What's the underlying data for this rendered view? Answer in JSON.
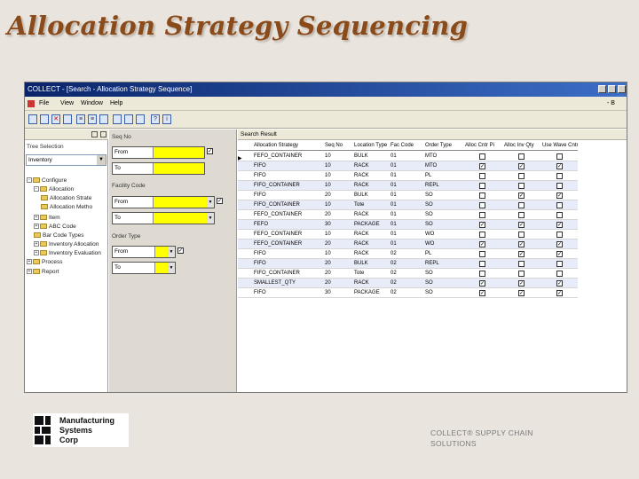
{
  "slide": {
    "title": "Allocation Strategy Sequencing",
    "footer_line1": "COLLECT® SUPPLY CHAIN",
    "footer_line2": "SOLUTIONS"
  },
  "logo": {
    "line1": "Manufacturing",
    "line2": "Systems",
    "line3": "Corp"
  },
  "window": {
    "title": "COLLECT - [Search - Allocation Strategy Sequence]",
    "menus": [
      "File",
      "View",
      "Window",
      "Help"
    ],
    "menu_right": "- B"
  },
  "left_panel": {
    "label": "Tree Selection",
    "combo_value": "Inventory",
    "tree": [
      {
        "label": "Configure",
        "level": 0,
        "expander": "-"
      },
      {
        "label": "Allocation",
        "level": 1,
        "expander": "-"
      },
      {
        "label": "Allocation Strate",
        "level": 2,
        "expander": ""
      },
      {
        "label": "Allocation Metho",
        "level": 2,
        "expander": ""
      },
      {
        "label": "Item",
        "level": 1,
        "expander": "+"
      },
      {
        "label": "ABC Code",
        "level": 1,
        "expander": "+"
      },
      {
        "label": "Bar Code Types",
        "level": 1,
        "expander": ""
      },
      {
        "label": "Inventory Allocation",
        "level": 1,
        "expander": "+"
      },
      {
        "label": "Inventory Evaluation",
        "level": 1,
        "expander": "+"
      },
      {
        "label": "Process",
        "level": 0,
        "expander": "+"
      },
      {
        "label": "Report",
        "level": 0,
        "expander": "+"
      }
    ]
  },
  "criteria": {
    "groups": [
      {
        "label": "Seq No",
        "from": "From",
        "to": "To"
      },
      {
        "label": "Facility Code",
        "from": "From",
        "to": "To"
      },
      {
        "label": "Order Type",
        "from": "From",
        "to": "To"
      }
    ]
  },
  "results": {
    "header": "Search Result",
    "columns": [
      "Allocation Strategy",
      "Seq No",
      "Location Type",
      "Fac Code",
      "Order Type",
      "Alloc Cntr Pi",
      "Alloc Inv Qty",
      "Use Wave Cntr"
    ],
    "rows": [
      {
        "strategy": "FEFO_CONTAINER",
        "seq": "10",
        "loc": "BULK",
        "fac": "01",
        "order": "MTO",
        "c1": false,
        "c2": false,
        "c3": false
      },
      {
        "strategy": "FIFO",
        "seq": "10",
        "loc": "RACK",
        "fac": "01",
        "order": "MTO",
        "c1": true,
        "c2": true,
        "c3": true
      },
      {
        "strategy": "FIFO",
        "seq": "10",
        "loc": "RACK",
        "fac": "01",
        "order": "PL",
        "c1": false,
        "c2": false,
        "c3": false
      },
      {
        "strategy": "FIFO_CONTAINER",
        "seq": "10",
        "loc": "RACK",
        "fac": "01",
        "order": "REPL",
        "c1": false,
        "c2": false,
        "c3": false
      },
      {
        "strategy": "FIFO",
        "seq": "20",
        "loc": "BULK",
        "fac": "01",
        "order": "SO",
        "c1": false,
        "c2": true,
        "c3": true
      },
      {
        "strategy": "FIFO_CONTAINER",
        "seq": "10",
        "loc": "Tote",
        "fac": "01",
        "order": "SO",
        "c1": false,
        "c2": false,
        "c3": false
      },
      {
        "strategy": "FEFO_CONTAINER",
        "seq": "20",
        "loc": "RACK",
        "fac": "01",
        "order": "SO",
        "c1": false,
        "c2": false,
        "c3": false
      },
      {
        "strategy": "FEFO",
        "seq": "30",
        "loc": "PACKAGE",
        "fac": "01",
        "order": "SO",
        "c1": true,
        "c2": true,
        "c3": true
      },
      {
        "strategy": "FEFO_CONTAINER",
        "seq": "10",
        "loc": "RACK",
        "fac": "01",
        "order": "WO",
        "c1": false,
        "c2": false,
        "c3": false
      },
      {
        "strategy": "FEFO_CONTAINER",
        "seq": "20",
        "loc": "RACK",
        "fac": "01",
        "order": "WO",
        "c1": true,
        "c2": true,
        "c3": true
      },
      {
        "strategy": "FIFO",
        "seq": "10",
        "loc": "RACK",
        "fac": "02",
        "order": "PL",
        "c1": false,
        "c2": true,
        "c3": true
      },
      {
        "strategy": "FIFO",
        "seq": "20",
        "loc": "BULK",
        "fac": "02",
        "order": "REPL",
        "c1": false,
        "c2": false,
        "c3": false
      },
      {
        "strategy": "FIFO_CONTAINER",
        "seq": "20",
        "loc": "Tote",
        "fac": "02",
        "order": "SO",
        "c1": false,
        "c2": false,
        "c3": false
      },
      {
        "strategy": "SMALLEST_QTY",
        "seq": "20",
        "loc": "RACK",
        "fac": "02",
        "order": "SO",
        "c1": true,
        "c2": true,
        "c3": true
      },
      {
        "strategy": "FIFO",
        "seq": "30",
        "loc": "PACKAGE",
        "fac": "02",
        "order": "SO",
        "c1": true,
        "c2": true,
        "c3": true
      }
    ]
  },
  "colors": {
    "title": "#8a4a1a",
    "titlebar_start": "#0a246a",
    "titlebar_end": "#3c6fc7",
    "criteria_highlight": "#ffff00",
    "row_alt": "#e8ecf8"
  }
}
